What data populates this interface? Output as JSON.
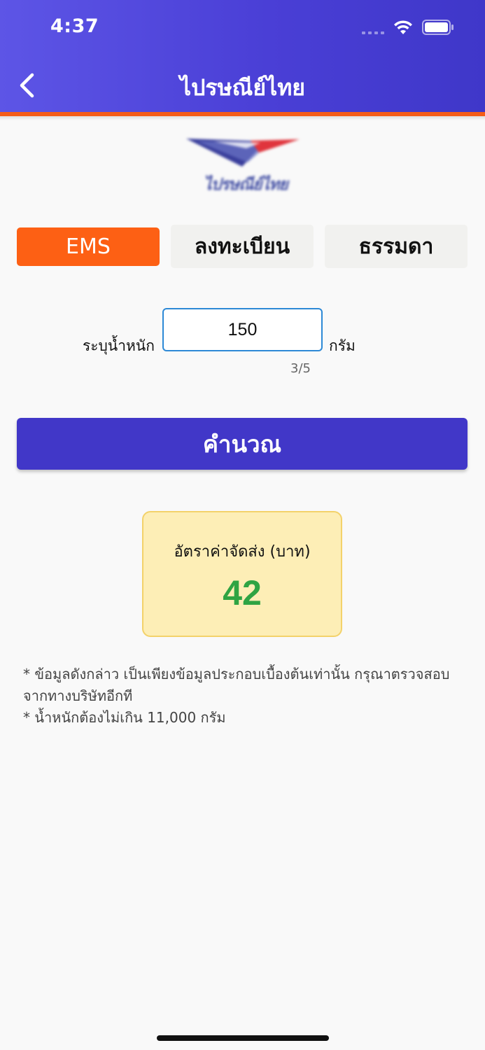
{
  "status_bar": {
    "time": "4:37"
  },
  "header": {
    "title": "ไปรษณีย์ไทย",
    "back_icon": "chevron-left-icon"
  },
  "logo": {
    "text": "ไปรษณีย์ไทย",
    "colors": {
      "blue": "#3a3f9c",
      "red": "#e0353d"
    }
  },
  "tabs": [
    {
      "label": "EMS",
      "selected": true
    },
    {
      "label": "ลงทะเบียน",
      "selected": false
    },
    {
      "label": "ธรรมดา",
      "selected": false
    }
  ],
  "weight": {
    "label": "ระบุน้ำหนัก",
    "value": "150",
    "unit": "กรัม",
    "counter": "3/5"
  },
  "calculate_button": {
    "label": "คำนวณ"
  },
  "result": {
    "label": "อัตราค่าจัดส่ง (บาท)",
    "value": "42"
  },
  "notes": [
    "* ข้อมูลดังกล่าว เป็นเพียงข้อมูลประกอบเบื้องต้นเท่านั้น กรุณาตรวจสอบจากทางบริษัทอีกที",
    "* น้ำหนักต้องไม่เกิน 11,000 กรัม"
  ],
  "colors": {
    "primary": "#4137c8",
    "accent": "#fd6014",
    "result_bg": "#fdeeb6",
    "result_value": "#2fa443"
  }
}
